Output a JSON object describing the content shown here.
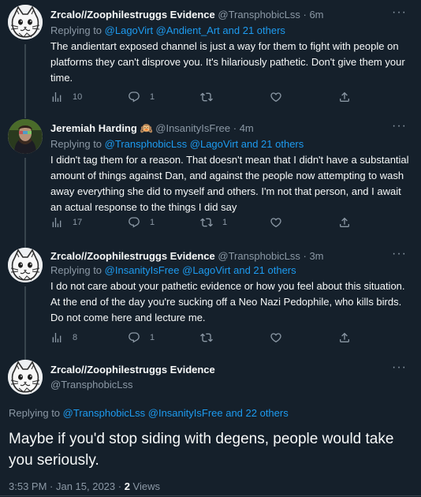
{
  "tweets": [
    {
      "name": "Zrcalo//Zoophilestruggs Evidence",
      "handle": "@TransphobicLss",
      "time": "6m",
      "replying_prefix": "Replying to",
      "replying_to": "@LagoVirt @Andient_Art and 21 others",
      "text": "The andientart exposed channel is just a way for them to fight with people on platforms they can't disprove you. It's hilariously pathetic. Don't give them your time.",
      "views": "10",
      "replies": "1",
      "retweets": "",
      "likes": ""
    },
    {
      "name": "Jeremiah Harding",
      "emoji": "🙉",
      "handle": "@InsanityIsFree",
      "time": "4m",
      "replying_prefix": "Replying to",
      "replying_to": "@TransphobicLss @LagoVirt and 21 others",
      "text": "I didn't tag them for a reason. That doesn't mean that I didn't have a substantial amount of things against Dan, and against the people now attempting to wash away everything she did to myself and others. I'm not that person, and I await an actual response to the things I did say",
      "views": "17",
      "replies": "1",
      "retweets": "1",
      "likes": ""
    },
    {
      "name": "Zrcalo//Zoophilestruggs Evidence",
      "handle": "@TransphobicLss",
      "time": "3m",
      "replying_prefix": "Replying to",
      "replying_to": "@InsanityIsFree @LagoVirt and 21 others",
      "text": "I do not care about your pathetic evidence or how you feel about this situation. At the end of the day you're sucking off a Neo Nazi Pedophile, who kills birds. Do not come here and lecture me.",
      "views": "8",
      "replies": "1",
      "retweets": "",
      "likes": ""
    }
  ],
  "main": {
    "name": "Zrcalo//Zoophilestruggs Evidence",
    "handle": "@TransphobicLss",
    "replying_prefix": "Replying to",
    "replying_to": "@TransphobicLss @InsanityIsFree and 22 others",
    "text": "Maybe if you'd stop siding with degens, people would take you seriously.",
    "timestamp": "3:53 PM · Jan 15, 2023 · ",
    "views_count": "2",
    "views_label": " Views"
  },
  "icons": {
    "views": "views-icon",
    "reply": "reply-icon",
    "retweet": "retweet-icon",
    "like": "like-icon",
    "share": "share-icon",
    "more": "more-icon"
  },
  "colors": {
    "background": "#15202b",
    "link": "#1d9bf0",
    "muted": "#8b98a5",
    "text": "#f7f9f9"
  }
}
